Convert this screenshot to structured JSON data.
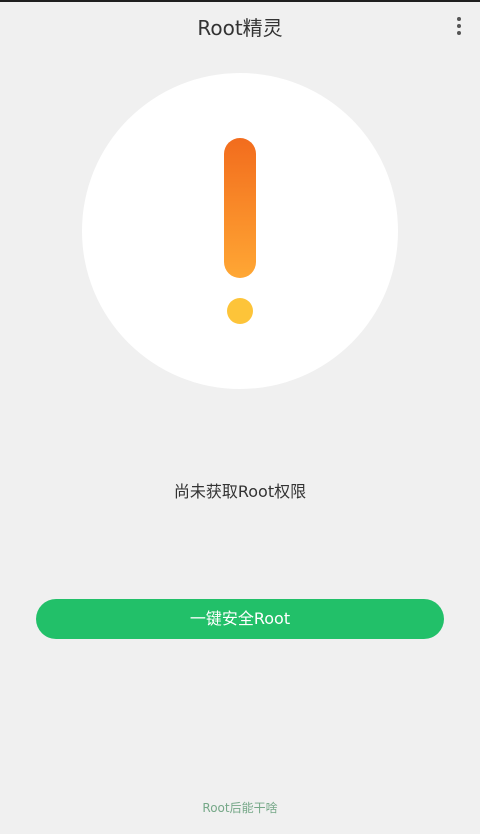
{
  "app_bar": {
    "title": "Root精灵",
    "more_icon": "more-vertical-icon"
  },
  "status": {
    "icon": "exclamation-icon",
    "colors": {
      "gradient_top": "#f26c1d",
      "gradient_bottom": "#ffa734",
      "dot": "#fdc439"
    },
    "text": "尚未获取Root权限"
  },
  "primary_action": {
    "label": "一键安全Root",
    "color": "#22c069"
  },
  "footer": {
    "link_text": "Root后能干啥"
  }
}
